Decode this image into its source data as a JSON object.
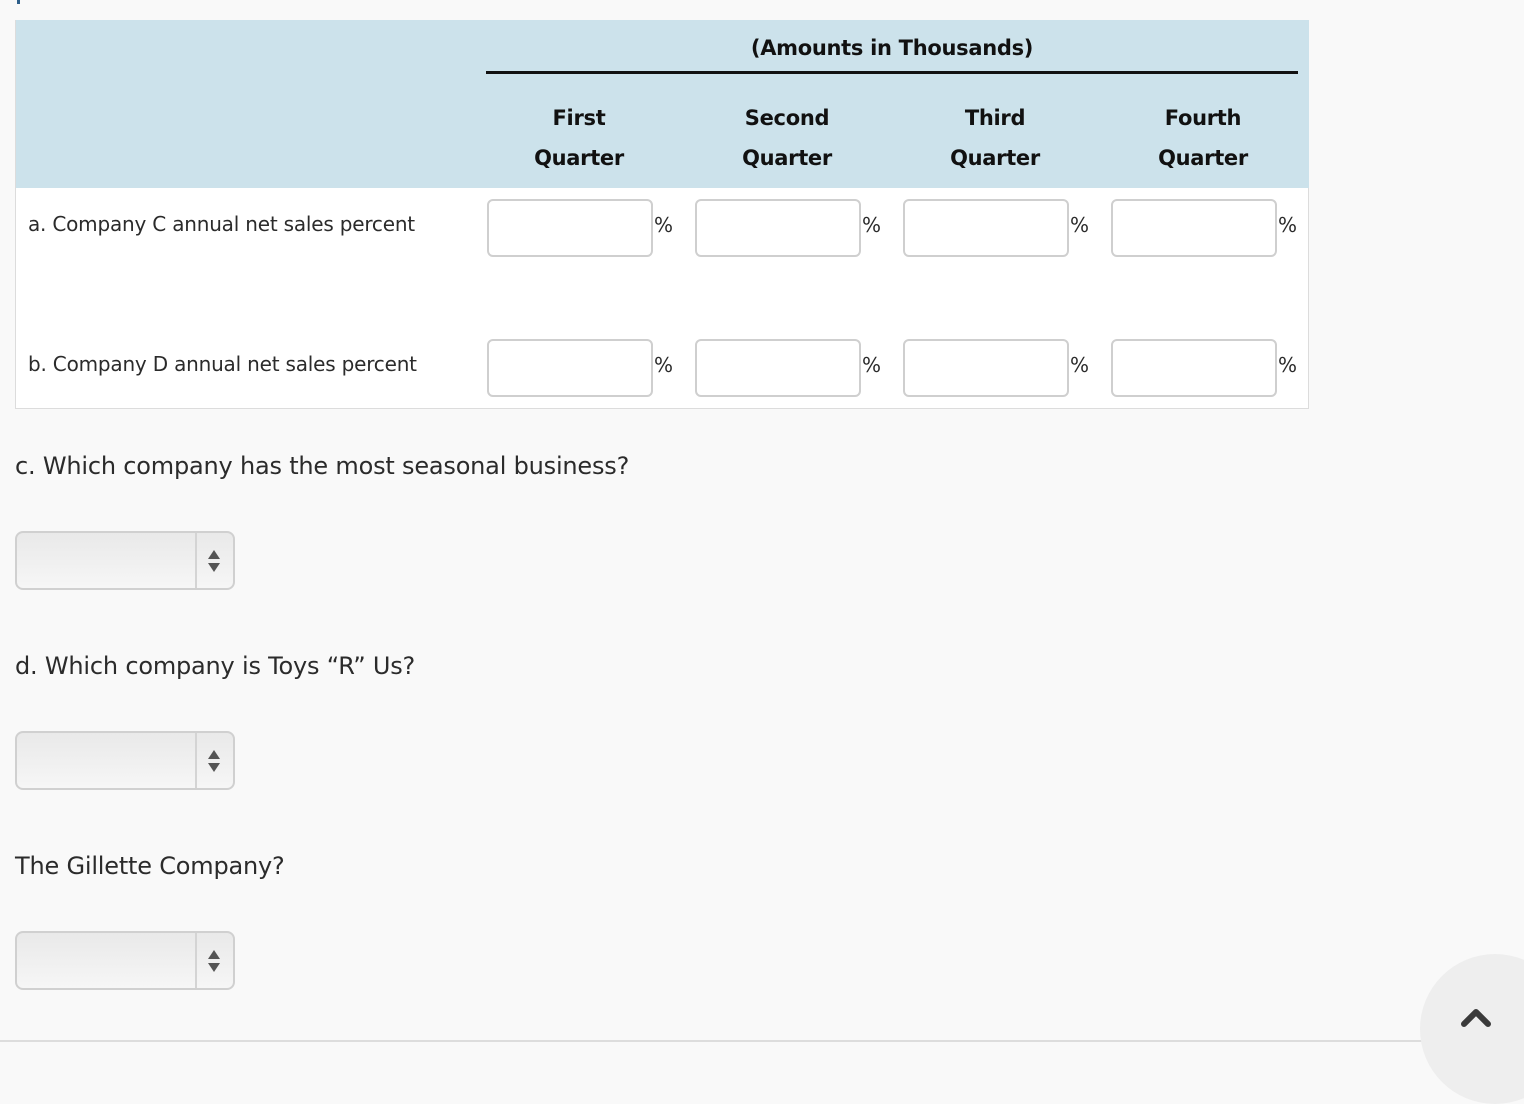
{
  "table": {
    "group_header": "(Amounts in Thousands)",
    "quarters": [
      {
        "line1": "First",
        "line2": "Quarter"
      },
      {
        "line1": "Second",
        "line2": "Quarter"
      },
      {
        "line1": "Third",
        "line2": "Quarter"
      },
      {
        "line1": "Fourth",
        "line2": "Quarter"
      }
    ],
    "rows": [
      {
        "label": "a. Company C annual net sales percent",
        "values": [
          "",
          "",
          "",
          ""
        ],
        "unit": "%"
      },
      {
        "label": "b. Company D annual net sales percent",
        "values": [
          "",
          "",
          "",
          ""
        ],
        "unit": "%"
      }
    ]
  },
  "questions": [
    {
      "text": "c. Which company has the most seasonal business?",
      "selected": ""
    },
    {
      "text": "d. Which company is Toys “R” Us?",
      "selected": ""
    },
    {
      "text": "The Gillette Company?",
      "selected": ""
    }
  ],
  "icons": {
    "select_arrows": "up-down-arrows-icon",
    "scroll_top": "chevron-up-icon"
  },
  "colors": {
    "header_bg": "#cce2eb",
    "page_bg": "#f9f9f9",
    "text": "#2b2b2b"
  }
}
